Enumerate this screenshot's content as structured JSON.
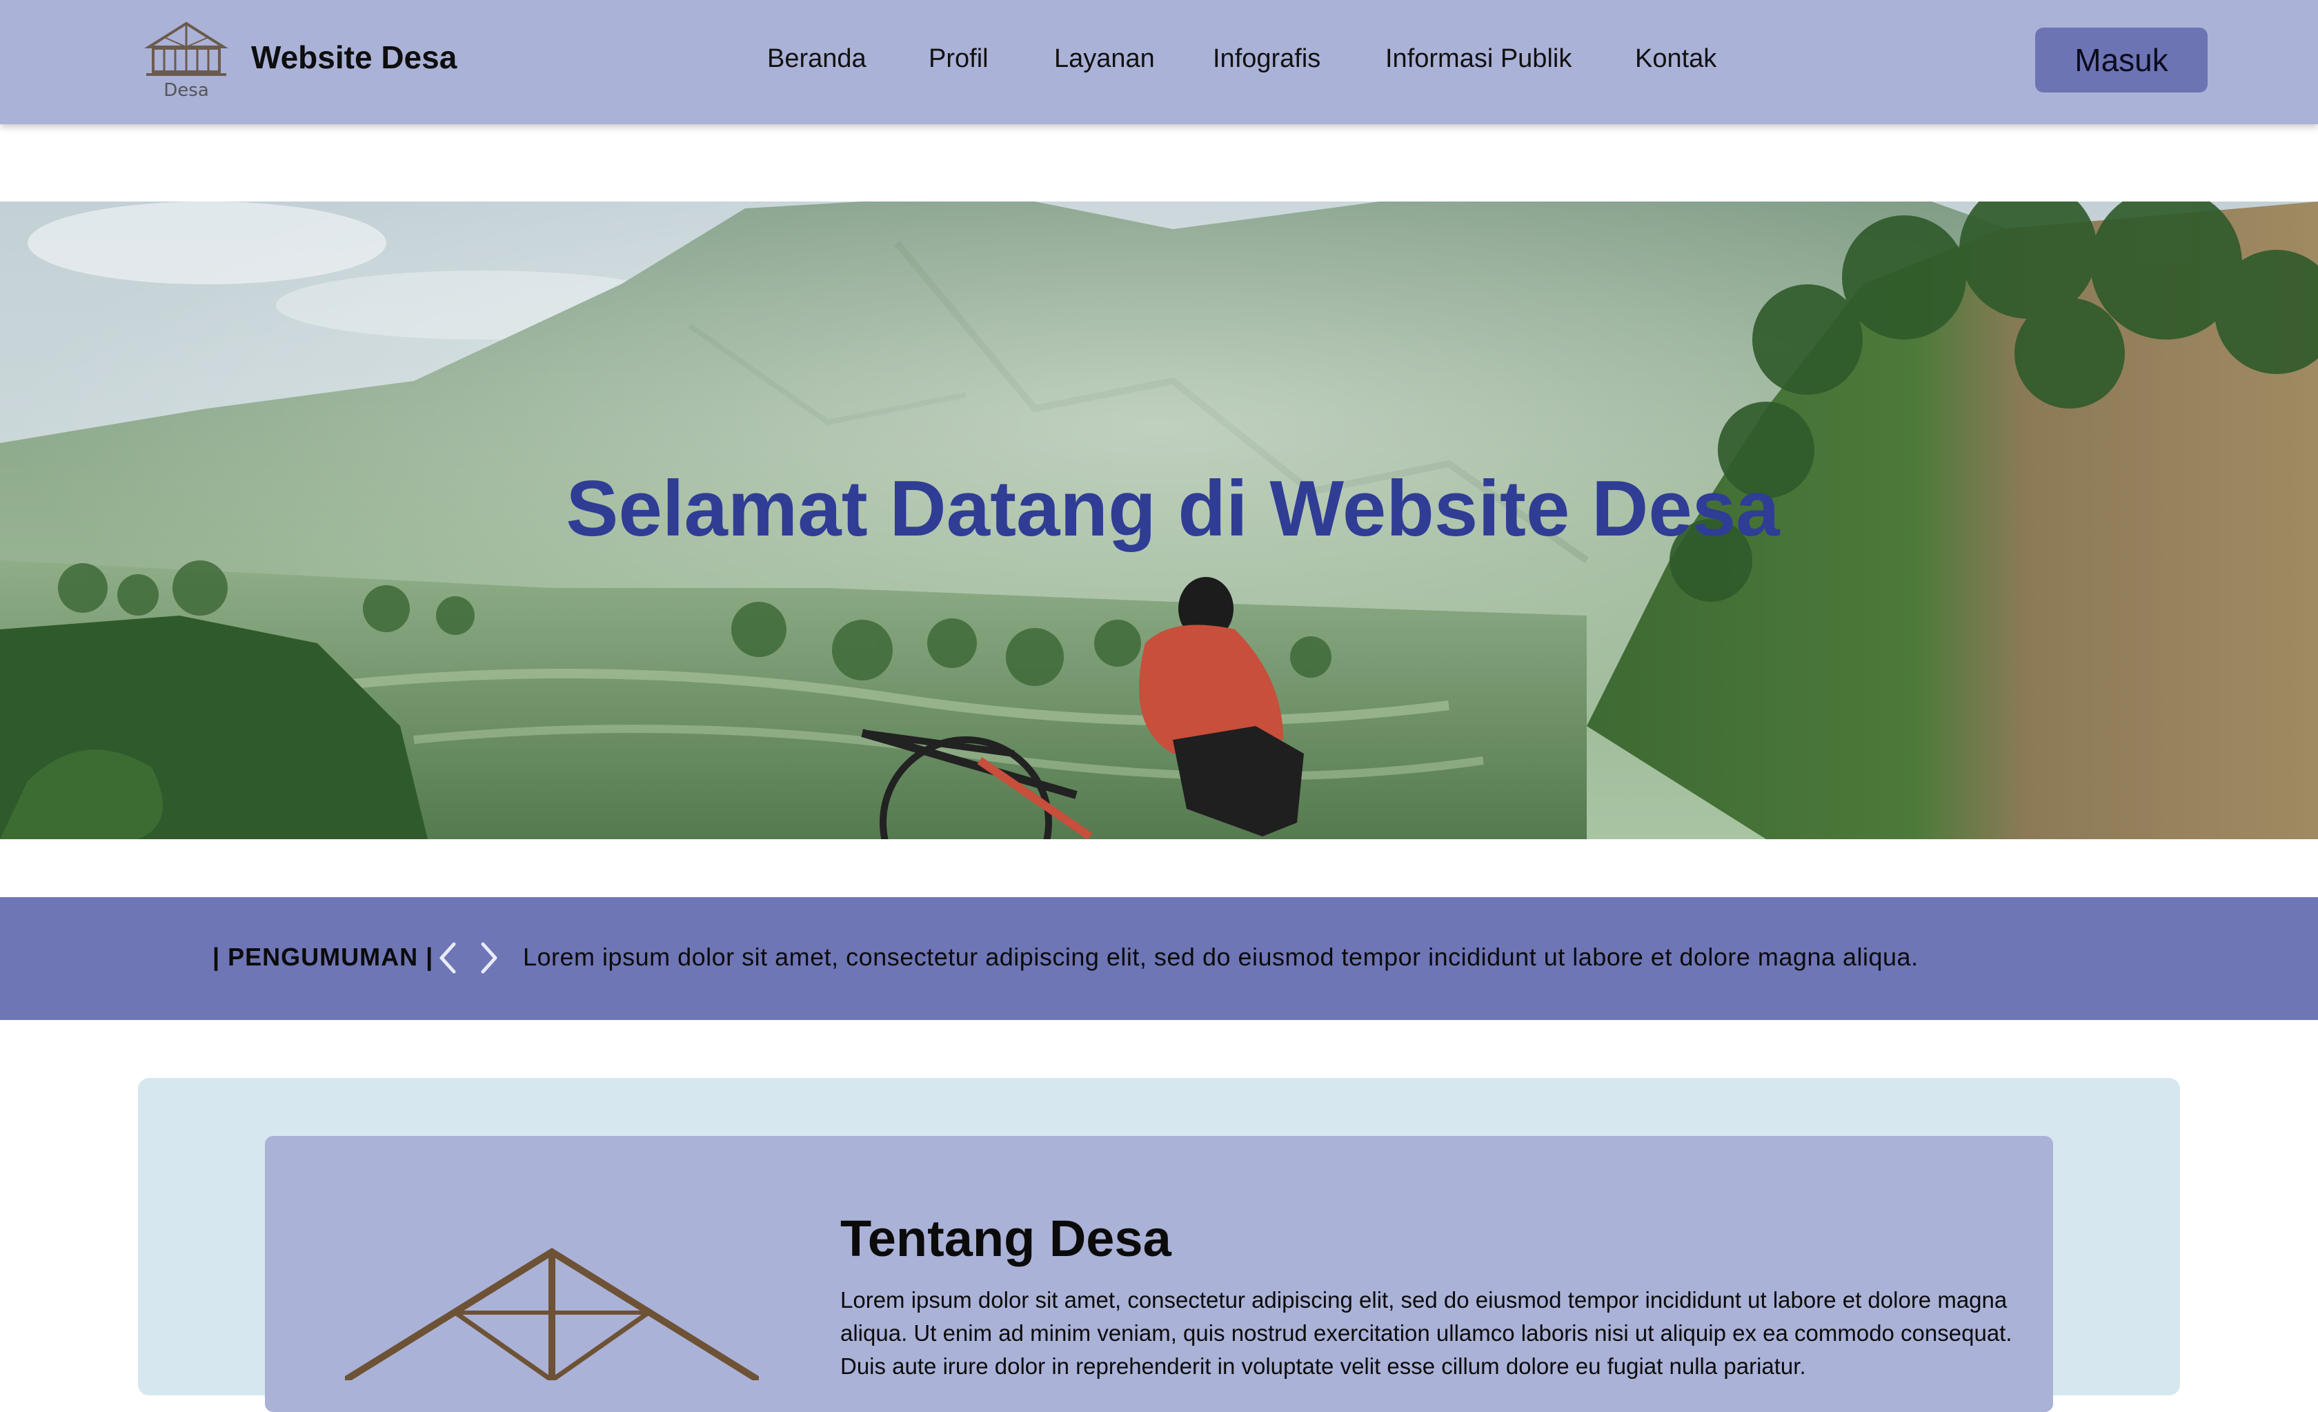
{
  "header": {
    "logo_label": "Desa",
    "brand": "Website Desa",
    "nav": [
      "Beranda",
      "Profil",
      "Layanan",
      "Infografis",
      "Informasi Publik",
      "Kontak"
    ],
    "login_label": "Masuk"
  },
  "hero": {
    "title": "Selamat Datang di Website Desa"
  },
  "announcement": {
    "label": "| PENGUMUMAN |",
    "text": "Lorem ipsum dolor sit amet, consectetur adipiscing elit, sed do eiusmod tempor incididunt ut labore et dolore magna aliqua."
  },
  "about": {
    "title": "Tentang Desa",
    "text": "Lorem ipsum dolor sit amet, consectetur adipiscing elit, sed do eiusmod tempor incididunt ut labore et dolore magna aliqua. Ut enim ad minim veniam, quis nostrud exercitation ullamco laboris nisi ut aliquip ex ea commodo consequat. Duis aute irure dolor in reprehenderit in voluptate velit esse cillum dolore eu fugiat nulla pariatur."
  },
  "colors": {
    "navbar": "#abb2d7",
    "button": "#6c74b3",
    "announcement_bar": "#6f76b6",
    "hero_title": "#2f3d95",
    "about_outer": "#d6e7ef",
    "about_card": "#abb2d7"
  },
  "icons": {
    "logo": "house-roof-icon",
    "prev": "chevron-left-icon",
    "next": "chevron-right-icon"
  }
}
